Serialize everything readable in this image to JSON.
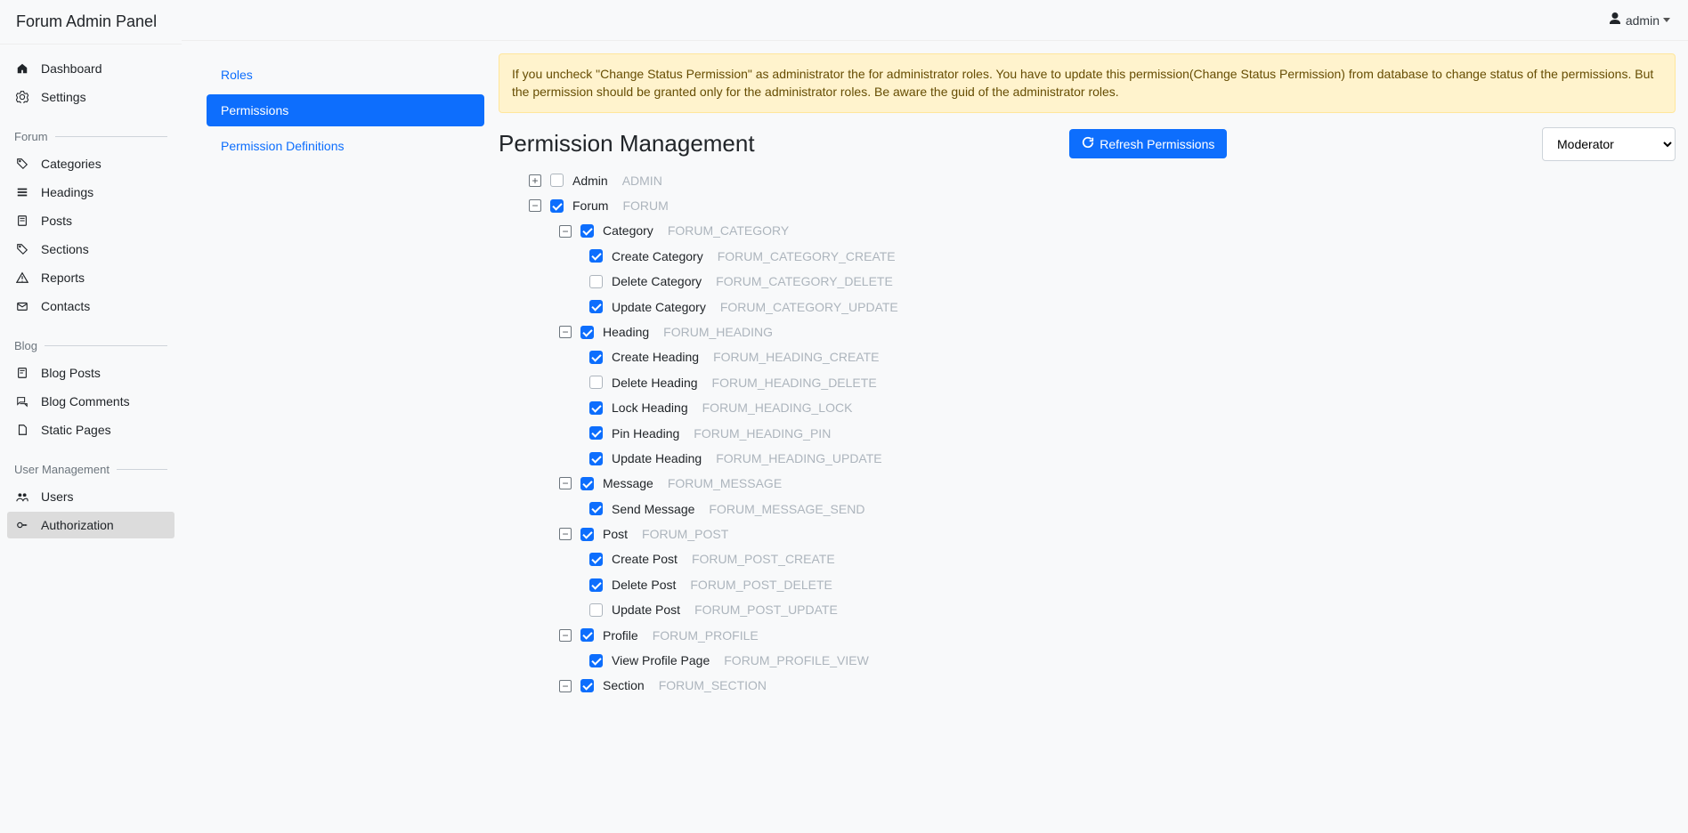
{
  "brand": "Forum Admin Panel",
  "user": "admin",
  "sidebar": {
    "top": [
      {
        "label": "Dashboard",
        "icon": "home"
      },
      {
        "label": "Settings",
        "icon": "gear"
      }
    ],
    "groups": [
      {
        "title": "Forum",
        "items": [
          {
            "label": "Categories",
            "icon": "tag"
          },
          {
            "label": "Headings",
            "icon": "lines"
          },
          {
            "label": "Posts",
            "icon": "note"
          },
          {
            "label": "Sections",
            "icon": "tag"
          },
          {
            "label": "Reports",
            "icon": "warn"
          },
          {
            "label": "Contacts",
            "icon": "envelope"
          }
        ]
      },
      {
        "title": "Blog",
        "items": [
          {
            "label": "Blog Posts",
            "icon": "post"
          },
          {
            "label": "Blog Comments",
            "icon": "comments"
          },
          {
            "label": "Static Pages",
            "icon": "page"
          }
        ]
      },
      {
        "title": "User Management",
        "items": [
          {
            "label": "Users",
            "icon": "users"
          },
          {
            "label": "Authorization",
            "icon": "key",
            "active": true
          }
        ]
      }
    ]
  },
  "subnav": [
    {
      "label": "Roles"
    },
    {
      "label": "Permissions",
      "active": true
    },
    {
      "label": "Permission Definitions"
    }
  ],
  "alert": "If you uncheck \"Change Status Permission\" as administrator the for administrator roles. You have to update this permission(Change Status Permission) from database to change status of the permissions. But the permission should be granted only for the administrator roles. Be aware the guid of the administrator roles.",
  "title": "Permission Management",
  "refresh_label": "Refresh Permissions",
  "role_select": "Moderator",
  "tree": [
    {
      "level": 1,
      "expander": "+",
      "checked": false,
      "label": "Admin",
      "code": "ADMIN"
    },
    {
      "level": 1,
      "expander": "-",
      "checked": true,
      "label": "Forum",
      "code": "FORUM"
    },
    {
      "level": 2,
      "expander": "-",
      "checked": true,
      "label": "Category",
      "code": "FORUM_CATEGORY"
    },
    {
      "level": 3,
      "checked": true,
      "label": "Create Category",
      "code": "FORUM_CATEGORY_CREATE"
    },
    {
      "level": 3,
      "checked": false,
      "label": "Delete Category",
      "code": "FORUM_CATEGORY_DELETE"
    },
    {
      "level": 3,
      "checked": true,
      "label": "Update Category",
      "code": "FORUM_CATEGORY_UPDATE"
    },
    {
      "level": 2,
      "expander": "-",
      "checked": true,
      "label": "Heading",
      "code": "FORUM_HEADING"
    },
    {
      "level": 3,
      "checked": true,
      "label": "Create Heading",
      "code": "FORUM_HEADING_CREATE"
    },
    {
      "level": 3,
      "checked": false,
      "label": "Delete Heading",
      "code": "FORUM_HEADING_DELETE"
    },
    {
      "level": 3,
      "checked": true,
      "label": "Lock Heading",
      "code": "FORUM_HEADING_LOCK"
    },
    {
      "level": 3,
      "checked": true,
      "label": "Pin Heading",
      "code": "FORUM_HEADING_PIN"
    },
    {
      "level": 3,
      "checked": true,
      "label": "Update Heading",
      "code": "FORUM_HEADING_UPDATE"
    },
    {
      "level": 2,
      "expander": "-",
      "checked": true,
      "label": "Message",
      "code": "FORUM_MESSAGE"
    },
    {
      "level": 3,
      "checked": true,
      "label": "Send Message",
      "code": "FORUM_MESSAGE_SEND"
    },
    {
      "level": 2,
      "expander": "-",
      "checked": true,
      "label": "Post",
      "code": "FORUM_POST"
    },
    {
      "level": 3,
      "checked": true,
      "label": "Create Post",
      "code": "FORUM_POST_CREATE"
    },
    {
      "level": 3,
      "checked": true,
      "label": "Delete Post",
      "code": "FORUM_POST_DELETE"
    },
    {
      "level": 3,
      "checked": false,
      "label": "Update Post",
      "code": "FORUM_POST_UPDATE"
    },
    {
      "level": 2,
      "expander": "-",
      "checked": true,
      "label": "Profile",
      "code": "FORUM_PROFILE"
    },
    {
      "level": 3,
      "checked": true,
      "label": "View Profile Page",
      "code": "FORUM_PROFILE_VIEW"
    },
    {
      "level": 2,
      "expander": "-",
      "checked": true,
      "label": "Section",
      "code": "FORUM_SECTION"
    }
  ]
}
